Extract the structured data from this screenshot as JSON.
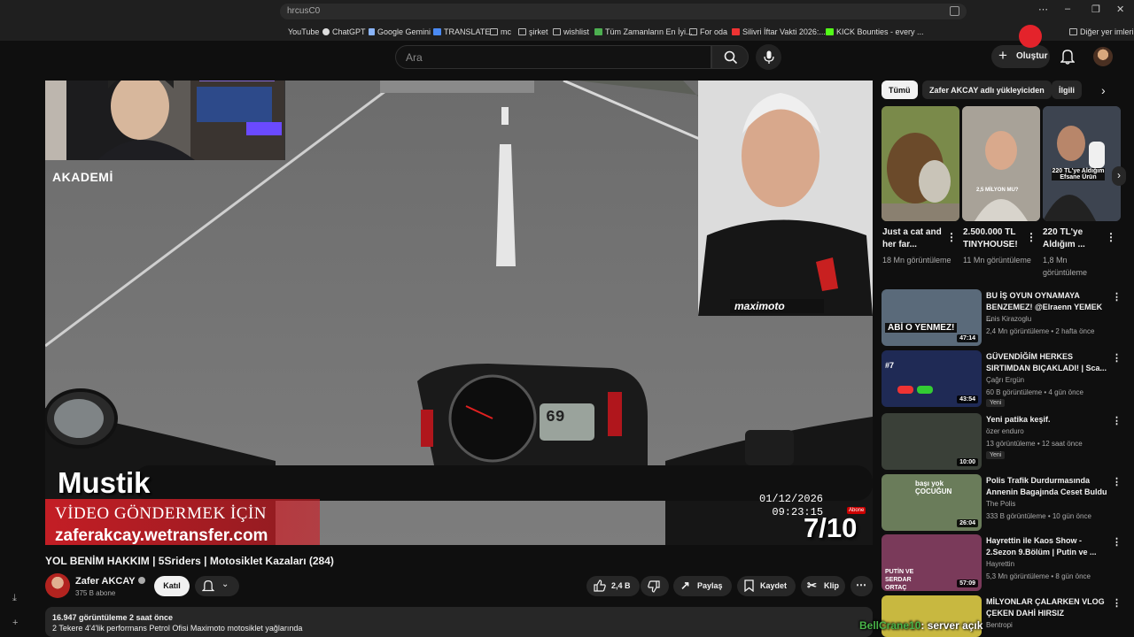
{
  "browser": {
    "address_text": "hrcusC0",
    "bookmarks": [
      {
        "label": "YouTube",
        "color": "#e22"
      },
      {
        "label": "ChatGPT",
        "color": "#ddd"
      },
      {
        "label": "Google Gemini",
        "color": "#8ab4f8"
      },
      {
        "label": "TRANSLATE",
        "color": "#4a8af4"
      },
      {
        "label": "mc",
        "color": "#bbb"
      },
      {
        "label": "şirket",
        "color": "#bbb"
      },
      {
        "label": "wishlist",
        "color": "#bbb"
      },
      {
        "label": "Tüm Zamanların En İyi...",
        "color": "#4caf50"
      },
      {
        "label": "For oda",
        "color": "#bbb"
      },
      {
        "label": "Silivri İftar Vakti 2026:...",
        "color": "#e33"
      },
      {
        "label": "KICK Bounties - every ...",
        "color": "#53fc18"
      }
    ],
    "other_bookmarks": "Diğer yer imleri"
  },
  "header": {
    "search_placeholder": "Ara",
    "create_label": "Oluştur"
  },
  "player": {
    "akademi_label": "AKADEMİ",
    "maximoto_label": "maximoto",
    "rider_name": "Mustik",
    "send_video_line": "VİDEO GÖNDERMEK İÇİN",
    "wetransfer_line": "zaferakcay.wetransfer.com",
    "date_text": "01/12/2026",
    "time_text": "09:23:15",
    "abone_label": "Abone",
    "counter_text": "7/10",
    "speedo_text": "69"
  },
  "video": {
    "title": "YOL BENİM HAKKIM | 5Sriders | Motosiklet Kazaları (284)",
    "channel_name": "Zafer AKCAY",
    "channel_subs": "375 B abone",
    "join_label": "Katıl",
    "likes": "2,4 B",
    "share_label": "Paylaş",
    "save_label": "Kaydet",
    "clip_label": "Klip",
    "views_line": "16.947 görüntüleme  2 saat önce",
    "description_line": "2 Tekere 4'4'lik performans Petrol Ofisi Maximoto motosiklet yağlarında"
  },
  "sidebar": {
    "chips": [
      {
        "label": "Tümü",
        "active": true
      },
      {
        "label": "Zafer AKCAY adlı yükleyiciden",
        "active": false
      },
      {
        "label": "İlgili",
        "active": false
      }
    ],
    "shorts": [
      {
        "title": "Just a cat and her far...",
        "views": "18 Mn görüntüleme",
        "thumb_color": "#6b5a3a"
      },
      {
        "title": "2.500.000 TL TINYHOUSE!",
        "views": "11 Mn görüntüleme",
        "thumb_color": "#9a9488",
        "overlay": "2,5 MİLYON MU?"
      },
      {
        "title": "220 TL'ye Aldığım ...",
        "views": "1,8 Mn görüntüleme",
        "thumb_color": "#3d4450",
        "overlay": "220 TL'ye Aldığım Efsane Ürün"
      }
    ],
    "recommendations": [
      {
        "title": "BU İŞ OYUN OYNAMAYA BENZEMEZ! @Elraenn YEMEK ...",
        "channel": "Enis Kirazoglu",
        "meta": "2,4 Mn görüntüleme • 2 hafta önce",
        "duration": "47:14",
        "is_new": false,
        "thumb_color": "#5a6a7a",
        "thumb_text": "ABİ O YENMEZ!"
      },
      {
        "title": "GÜVENDİĞİM HERKES SIRTIMDAN BIÇAKLADI! | Sca...",
        "channel": "Çağrı Ergün",
        "meta": "60 B görüntüleme • 4 gün önce",
        "duration": "43:54",
        "is_new": true,
        "thumb_color": "#1f2a55",
        "thumb_text": "#7"
      },
      {
        "title": "Yeni patika keşif.",
        "channel": "özer enduro",
        "meta": "13 görüntüleme • 12 saat önce",
        "duration": "10:00",
        "is_new": true,
        "thumb_color": "#3a4038",
        "thumb_text": ""
      },
      {
        "title": "Polis Trafik Durdurmasında Annenin Bagajında Ceset Buldu",
        "channel": "The Polis",
        "meta": "333 B görüntüleme • 10 gün önce",
        "duration": "26:04",
        "is_new": false,
        "thumb_color": "#6a7c5a",
        "thumb_text": "başı yok ÇOCUĞUN"
      },
      {
        "title": "Hayrettin ile Kaos Show - 2.Sezon 9.Bölüm | Putin ve ...",
        "channel": "Hayrettin",
        "meta": "5,3 Mn görüntüleme • 8 gün önce",
        "duration": "57:09",
        "is_new": false,
        "thumb_color": "#7a3a5a",
        "thumb_text": "PUTİN VE SERDAR ORTAÇ"
      },
      {
        "title": "MİLYONLAR ÇALARKEN VLOG ÇEKEN DAHİ HIRSIZ",
        "channel": "Bentropi",
        "meta": "",
        "duration": "",
        "is_new": false,
        "thumb_color": "#c8b840",
        "thumb_text": ""
      }
    ]
  },
  "chat_overlay": {
    "user": "BellCrane10",
    "message": ": server açık"
  },
  "colors": {
    "background": "#0f0f0f",
    "accent_red": "#cd1e26",
    "chip_bg": "#272727"
  }
}
